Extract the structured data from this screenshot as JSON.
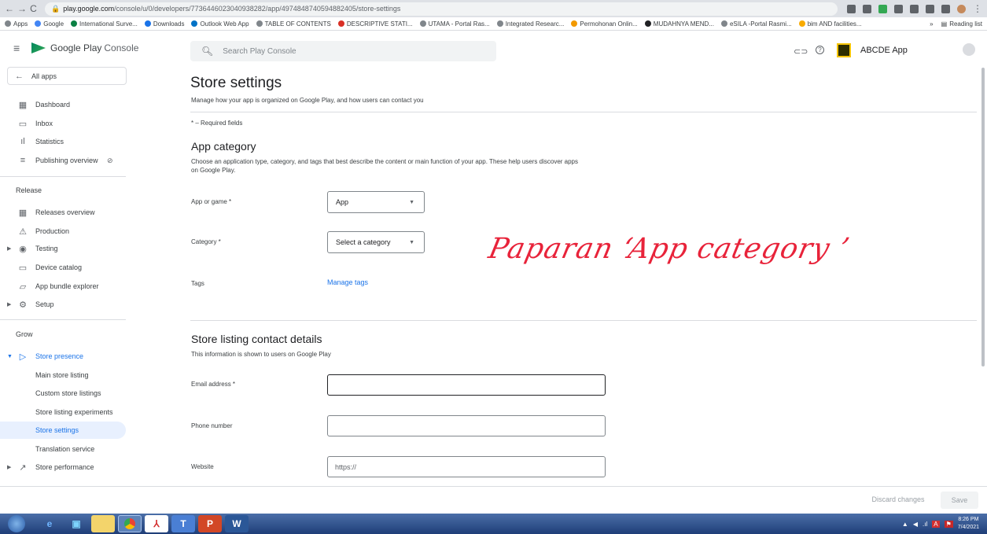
{
  "browser": {
    "url_host": "play.google.com",
    "url_path": "/console/u/0/developers/7736446023040938282/app/4974848740594882405/store-settings",
    "bookmarks": [
      "Apps",
      "Google",
      "International Surve...",
      "Downloads",
      "Outlook Web App",
      "TABLE OF CONTENTS",
      "DESCRIPTIVE STATI...",
      "UTAMA - Portal Ras...",
      "Integrated Researc...",
      "Permohonan Onlin...",
      "MUDAHNYA MEND...",
      "eSILA -Portal Rasmi...",
      "bim AND facilities..."
    ],
    "reading_list": "Reading list"
  },
  "console": {
    "logo_google": "Google Play",
    "logo_console": "Console",
    "search_placeholder": "Search Play Console",
    "app_name": "ABCDE App"
  },
  "sidebar": {
    "all_apps": "All apps",
    "items_top": [
      "Dashboard",
      "Inbox",
      "Statistics",
      "Publishing overview"
    ],
    "release_header": "Release",
    "release_items": [
      "Releases overview",
      "Production",
      "Testing",
      "Device catalog",
      "App bundle explorer",
      "Setup"
    ],
    "grow_header": "Grow",
    "store_presence": "Store presence",
    "store_presence_items": [
      "Main store listing",
      "Custom store listings",
      "Store listing experiments",
      "Store settings",
      "Translation service"
    ],
    "store_performance": "Store performance"
  },
  "main": {
    "title": "Store settings",
    "subtitle": "Manage how your app is organized on Google Play, and how users can contact you",
    "required_note": "* – Required fields",
    "app_category": {
      "heading": "App category",
      "description_1": "Choose an application type, category, and tags that best describe the content or main function of your app. These help users discover apps",
      "description_2": "on Google Play.",
      "app_or_game_label": "App or game *",
      "app_or_game_value": "App",
      "category_label": "Category *",
      "category_value": "Select a category",
      "tags_label": "Tags",
      "manage_tags": "Manage tags"
    },
    "contact": {
      "heading": "Store listing contact details",
      "description": "This information is shown to users on Google Play",
      "email_label": "Email address *",
      "email_value": "",
      "phone_label": "Phone number",
      "phone_value": "",
      "website_label": "Website",
      "website_placeholder": "https://"
    },
    "annotation": "Paparan ‘App category ’"
  },
  "footer": {
    "discard": "Discard changes",
    "save": "Save"
  },
  "taskbar": {
    "time": "8:26 PM",
    "date": "7/4/2021"
  },
  "colors": {
    "accent": "#1a73e8",
    "annotation": "#e8233a",
    "taskbar": "#1f3e78"
  }
}
